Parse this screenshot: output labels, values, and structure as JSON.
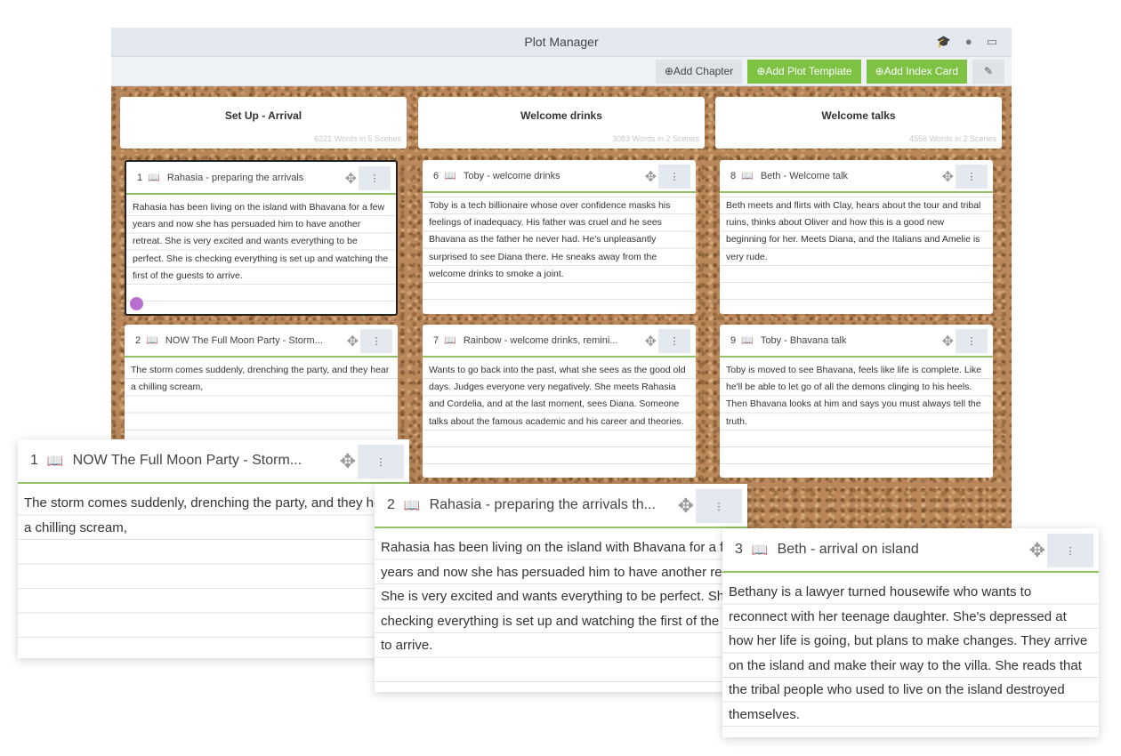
{
  "window": {
    "title": "Plot Manager"
  },
  "toolbar": {
    "add_chapter": "⊕Add Chapter",
    "add_plot_template": "⊕Add Plot Template",
    "add_index_card": "⊕Add Index Card"
  },
  "chapters": [
    {
      "title": "Set Up - Arrival",
      "count": "6321 Words in 5 Scenes"
    },
    {
      "title": "Welcome drinks",
      "count": "3083 Words in 2 Scenes"
    },
    {
      "title": "Welcome talks",
      "count": "4556 Words in 2 Scenes"
    }
  ],
  "cards": [
    {
      "num": "1",
      "title": "Rahasia - preparing the arrivals",
      "text": "Rahasia has been living on the island with Bhavana for a few years and now she has persuaded him to have another retreat. She is very excited and wants everything to be perfect. She is checking everything is set up and watching the first of the guests to arrive."
    },
    {
      "num": "2",
      "title": "NOW The Full Moon Party - Storm...",
      "text": "The storm comes suddenly, drenching the party, and they hear a chilling scream,"
    },
    {
      "num": "6",
      "title": "Toby - welcome drinks",
      "text": "Toby is a tech billionaire whose over confidence masks his feelings of inadequacy. His father was cruel and he sees Bhavana as the father he never had. He's unpleasantly surprised to see Diana there. He sneaks away from the welcome drinks to smoke a joint."
    },
    {
      "num": "7",
      "title": "Rainbow - welcome drinks, remini...",
      "text": "Wants to go back into the past, what she sees as the good old days. Judges everyone very negatively. She meets Rahasia and Cordelia, and at  the last moment, sees Diana. Someone talks about the famous academic and his career and theories."
    },
    {
      "num": "8",
      "title": "Beth - Welcome talk",
      "text": "Beth meets and flirts with Clay, hears about the tour and tribal ruins, thinks about Oliver and how this is a good new beginning for her. Meets Diana, and the Italians and Amelie is very rude."
    },
    {
      "num": "9",
      "title": "Toby - Bhavana talk",
      "text": "Toby is moved to see Bhavana, feels like life is complete. Like he'll be able to let go of all the demons clinging to his heels. Then Bhavana looks at him and says you must always tell the truth."
    }
  ],
  "big_cards": [
    {
      "num": "1",
      "title": "NOW The Full Moon Party - Storm...",
      "text": "The storm comes suddenly, drenching the party, and they hear a chilling scream,"
    },
    {
      "num": "2",
      "title": "Rahasia - preparing the arrivals th...",
      "text": "Rahasia has been living on the island with Bhavana for a few years and now she has persuaded him to have another retreat. She is very excited and wants everything to be perfect. She is checking everything is set up and watching the first of the guests to arrive."
    },
    {
      "num": "3",
      "title": "Beth - arrival on island",
      "text": "Bethany is a lawyer turned housewife who wants to reconnect with her teenage daughter. She's depressed at how her life is going, but plans to make changes. They arrive on the island and make their way to the villa. She reads that the tribal people who used to live on the island destroyed themselves."
    }
  ],
  "colors": {
    "accent_green": "#7dc243",
    "card_underline": "#93c165",
    "dot_purple": "#b76fcf"
  },
  "icons": {
    "book": "book-icon",
    "move": "move-icon",
    "menu": "kebab-menu-icon",
    "link": "paperclip-icon",
    "graduation": "graduation-cap-icon",
    "info": "info-icon",
    "monitor": "monitor-icon"
  }
}
